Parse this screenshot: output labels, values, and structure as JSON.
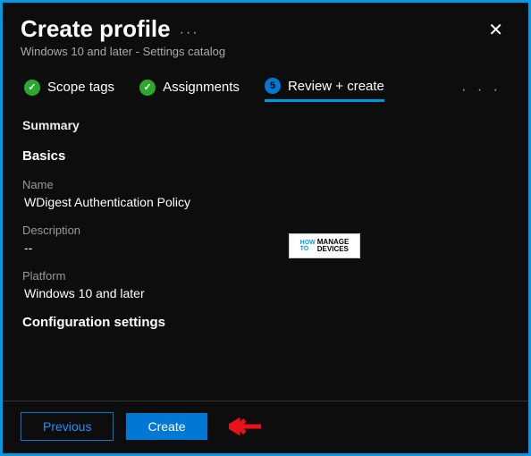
{
  "header": {
    "title": "Create profile",
    "subtitle": "Windows 10 and later - Settings catalog"
  },
  "tabs": {
    "items": [
      {
        "label": "Scope tags",
        "badge": "✓",
        "completed": true
      },
      {
        "label": "Assignments",
        "badge": "✓",
        "completed": true
      },
      {
        "label": "Review + create",
        "badge": "5",
        "active": true
      }
    ]
  },
  "summary": {
    "heading": "Summary",
    "basics_heading": "Basics",
    "fields": {
      "name_label": "Name",
      "name_value": "WDigest Authentication Policy",
      "description_label": "Description",
      "description_value": "--",
      "platform_label": "Platform",
      "platform_value": "Windows 10 and later"
    },
    "config_heading": "Configuration settings"
  },
  "footer": {
    "previous_label": "Previous",
    "create_label": "Create"
  },
  "watermark": {
    "line1": "HOW",
    "line2": "TO",
    "line3a": "MANAGE",
    "line3b": "DEVICES"
  }
}
